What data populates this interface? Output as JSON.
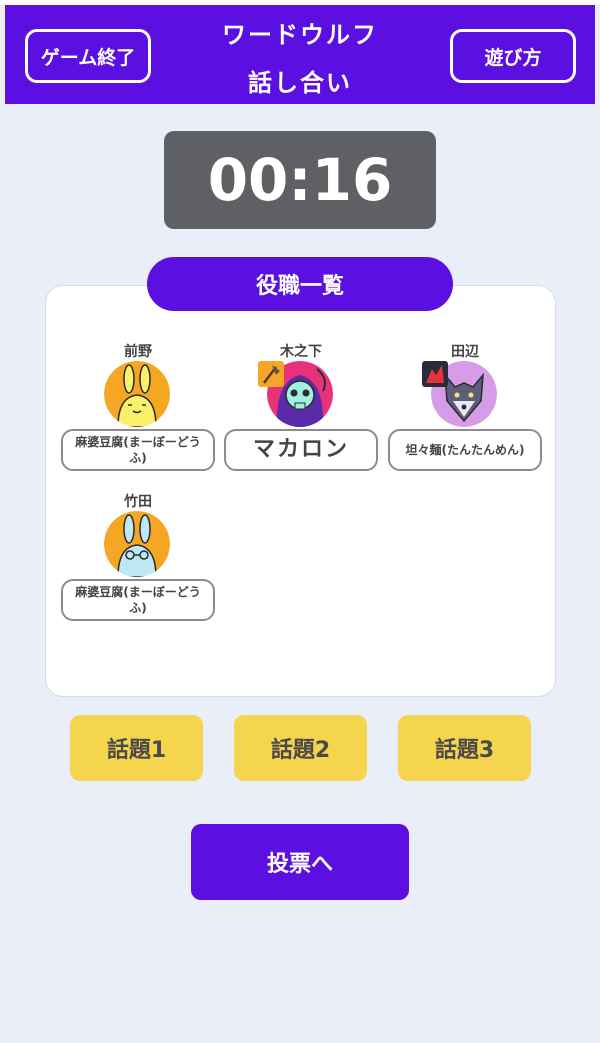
{
  "header": {
    "end_game_label": "ゲーム終了",
    "title": "ワードウルフ",
    "subtitle": "話し合い",
    "how_to_play_label": "遊び方",
    "color": "#5b0fe0"
  },
  "timer": {
    "value": "00:16"
  },
  "roles": {
    "heading": "役職一覧",
    "players": [
      {
        "name": "前野",
        "avatar": "yellow-rabbit-icon",
        "badge": null,
        "word": "麻婆豆腐(まーぼーどうふ)"
      },
      {
        "name": "木之下",
        "avatar": "skull-reaper-icon",
        "badge": "axe-badge-icon",
        "word": "マカロン"
      },
      {
        "name": "田辺",
        "avatar": "wolf-icon",
        "badge": "werewolf-badge-icon",
        "word": "坦々麺(たんたんめん)"
      },
      {
        "name": "竹田",
        "avatar": "blue-rabbit-icon",
        "badge": null,
        "word": "麻婆豆腐(まーぼーどうふ)"
      }
    ]
  },
  "topics": [
    "話題1",
    "話題2",
    "話題3"
  ],
  "vote_label": "投票へ",
  "colors": {
    "accent": "#5b0fe0",
    "topic": "#f5d44e",
    "timer": "#5f6064"
  }
}
